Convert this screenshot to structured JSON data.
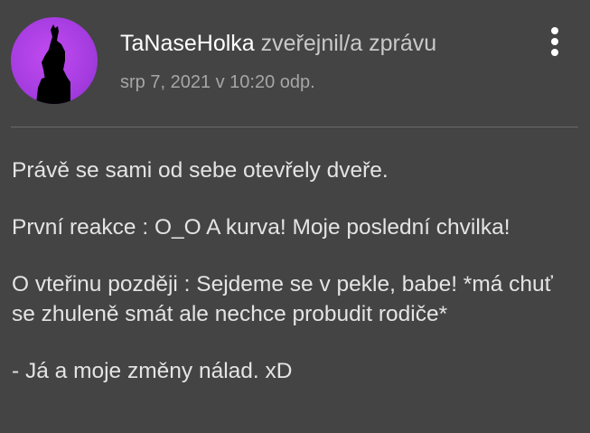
{
  "post": {
    "author": "TaNaseHolka",
    "action": "zveřejnil/a zprávu",
    "timestamp": "srp 7, 2021 v 10:20 odp.",
    "paragraphs": [
      "Právě se sami od sebe otevřely dveře.",
      "První reakce : O_O A kurva! Moje poslední chvilka!",
      "O vteřinu později : Sejdeme se v pekle, babe! *má chuť se zhuleně smát ale nechce probudit rodiče*",
      "- Já a moje změny nálad. xD"
    ]
  },
  "icons": {
    "avatar": "howling-wolf-silhouette",
    "menu": "more-vertical-icon"
  },
  "colors": {
    "background": "#444444",
    "avatar_bg": "#a83ee2",
    "author": "#ffffff",
    "text": "#e4e4e4",
    "muted": "#a6a6a6"
  }
}
